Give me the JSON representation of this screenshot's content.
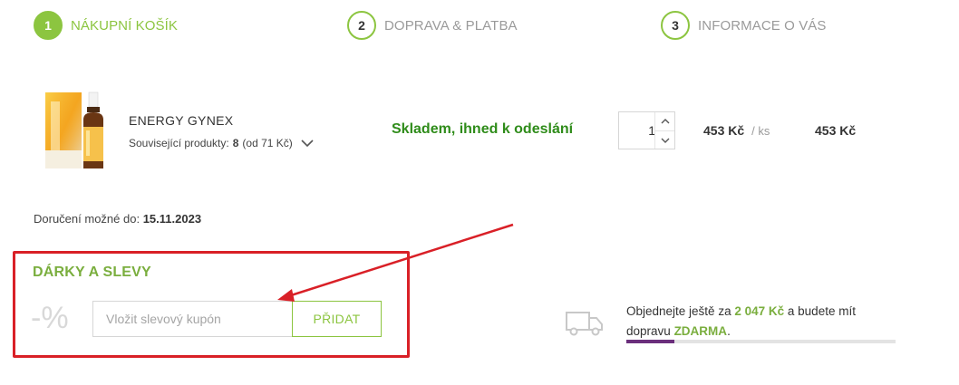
{
  "steps": [
    {
      "number": "1",
      "label": "NÁKUPNÍ KOŠÍK",
      "active": true
    },
    {
      "number": "2",
      "label": "DOPRAVA & PLATBA",
      "active": false
    },
    {
      "number": "3",
      "label": "INFORMACE O VÁS",
      "active": false
    }
  ],
  "product": {
    "name": "ENERGY GYNEX",
    "related_prefix": "Související produkty:",
    "related_count": "8",
    "related_price": "(od 71 Kč)",
    "stock": "Skladem, ihned k odeslání",
    "quantity": "1",
    "unit_price": "453 Kč",
    "unit_suffix": "/ ks",
    "total_price": "453 Kč"
  },
  "delivery": {
    "label": "Doručení možné do:",
    "date": "15.11.2023"
  },
  "coupon": {
    "title": "DÁRKY A SLEVY",
    "percent_symbol": "-%",
    "placeholder": "Vložit slevový kupón",
    "button_label": "PŘIDAT"
  },
  "free_shipping": {
    "text_before": "Objednejte ještě za",
    "amount": "2 047 Kč",
    "text_middle": "a budete mít dopravu",
    "free_word": "ZDARMA",
    "text_end": ".",
    "progress_fraction": 0.18
  },
  "colors": {
    "accent_green": "#8cc540",
    "stock_green": "#2f8c1a",
    "highlight_red": "#d92027",
    "progress_purple": "#6b2f7c"
  }
}
